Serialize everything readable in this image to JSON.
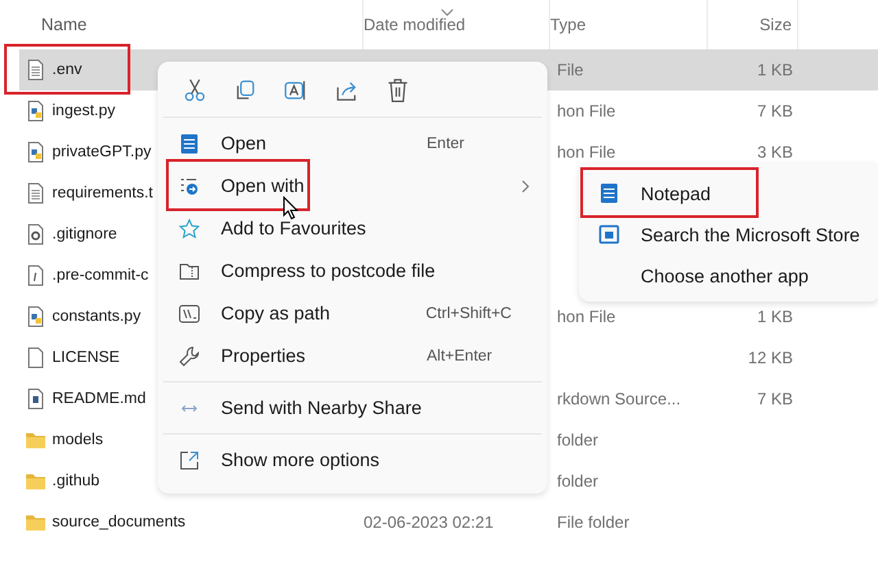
{
  "columns": [
    {
      "label": "Name",
      "sorted": false
    },
    {
      "label": "Date modified",
      "sorted": true
    },
    {
      "label": "Type",
      "sorted": false
    },
    {
      "label": "Size",
      "sorted": false
    }
  ],
  "files": [
    {
      "name": ".env",
      "kind": "text",
      "type": "File",
      "size": "1 KB",
      "selected": true,
      "highlighted": true
    },
    {
      "name": "ingest.py",
      "kind": "python",
      "type": "hon File",
      "size": "7 KB",
      "selected": false,
      "highlighted": false
    },
    {
      "name": "privateGPT.py",
      "kind": "python",
      "type": "hon File",
      "size": "3 KB",
      "selected": false,
      "highlighted": false
    },
    {
      "name": "requirements.t",
      "kind": "text",
      "selected": false,
      "highlighted": false
    },
    {
      "name": ".gitignore",
      "kind": "gear",
      "selected": false,
      "highlighted": false
    },
    {
      "name": ".pre-commit-c",
      "kind": "config",
      "selected": false,
      "highlighted": false
    },
    {
      "name": "constants.py",
      "kind": "python",
      "type": "hon File",
      "size": "1 KB",
      "selected": false,
      "highlighted": false
    },
    {
      "name": "LICENSE",
      "kind": "blank",
      "size": "12 KB",
      "selected": false,
      "highlighted": false
    },
    {
      "name": "README.md",
      "kind": "markdown",
      "type": "rkdown Source...",
      "size": "7 KB",
      "selected": false,
      "highlighted": false
    },
    {
      "name": "models",
      "kind": "folder",
      "type": "folder",
      "selected": false,
      "highlighted": false
    },
    {
      "name": ".github",
      "kind": "folder",
      "type": "folder",
      "selected": false,
      "highlighted": false
    },
    {
      "name": "source_documents",
      "kind": "folder",
      "date": "02-06-2023 02:21",
      "type": "File folder",
      "selected": false,
      "highlighted": false
    }
  ],
  "context_menu": {
    "toolbar": [
      {
        "kind": "cut"
      },
      {
        "kind": "copy"
      },
      {
        "kind": "rename"
      },
      {
        "kind": "share"
      },
      {
        "kind": "delete"
      }
    ],
    "sections": [
      [
        {
          "label": "Open",
          "kind": "notepad",
          "shortcut": "Enter",
          "submenu": false,
          "highlighted": false
        },
        {
          "label": "Open with",
          "kind": "openwith",
          "submenu": true,
          "highlighted": true
        },
        {
          "label": "Add to Favourites",
          "kind": "star",
          "submenu": false,
          "highlighted": false
        },
        {
          "label": "Compress to postcode file",
          "kind": "zip",
          "submenu": false,
          "highlighted": false
        },
        {
          "label": "Copy as path",
          "kind": "path",
          "shortcut": "Ctrl+Shift+C",
          "submenu": false,
          "highlighted": false
        },
        {
          "label": "Properties",
          "kind": "wrench",
          "shortcut": "Alt+Enter",
          "submenu": false,
          "highlighted": false
        }
      ],
      [
        {
          "label": "Send with Nearby Share",
          "kind": "nearby",
          "submenu": false,
          "highlighted": false
        }
      ],
      [
        {
          "label": "Show more options",
          "kind": "more",
          "submenu": false,
          "highlighted": false
        }
      ]
    ]
  },
  "submenu": [
    {
      "label": "Notepad",
      "kind": "notepad",
      "highlighted": true
    },
    {
      "label": "Search the Microsoft Store",
      "kind": "store",
      "highlighted": false
    },
    {
      "label": "Choose another app",
      "kind": "app",
      "highlighted": false
    }
  ]
}
